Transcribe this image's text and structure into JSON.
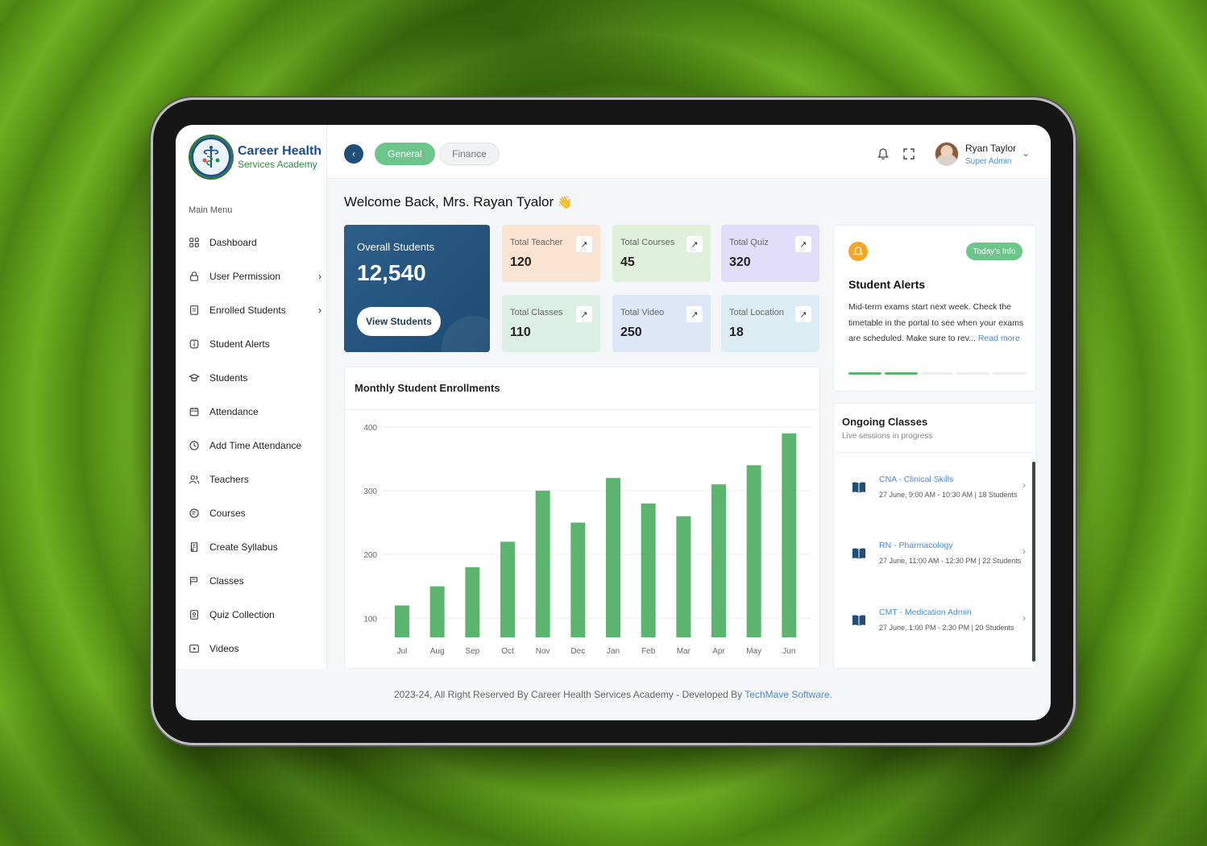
{
  "brand": {
    "title": "Career Health",
    "subtitle": "Services Academy"
  },
  "sidebar": {
    "menu_label": "Main Menu",
    "items": [
      {
        "label": "Dashboard",
        "icon": "grid-icon",
        "has_children": false
      },
      {
        "label": "User Permission",
        "icon": "lock-icon",
        "has_children": true
      },
      {
        "label": "Enrolled Students",
        "icon": "document-icon",
        "has_children": true
      },
      {
        "label": "Student Alerts",
        "icon": "info-icon",
        "has_children": false
      },
      {
        "label": "Students",
        "icon": "graduation-icon",
        "has_children": false
      },
      {
        "label": "Attendance",
        "icon": "calendar-icon",
        "has_children": false
      },
      {
        "label": "Add Time Attendance",
        "icon": "clock-icon",
        "has_children": false
      },
      {
        "label": "Teachers",
        "icon": "users-icon",
        "has_children": false
      },
      {
        "label": "Courses",
        "icon": "book-icon",
        "has_children": false
      },
      {
        "label": "Create Syllabus",
        "icon": "syllabus-icon",
        "has_children": false
      },
      {
        "label": "Classes",
        "icon": "classes-icon",
        "has_children": false
      },
      {
        "label": "Quiz Collection",
        "icon": "quiz-icon",
        "has_children": false
      },
      {
        "label": "Videos",
        "icon": "video-icon",
        "has_children": false
      }
    ]
  },
  "header": {
    "tabs": [
      {
        "label": "General",
        "active": true
      },
      {
        "label": "Finance",
        "active": false
      }
    ],
    "user": {
      "name": "Ryan Taylor",
      "role": "Super Admin"
    }
  },
  "welcome": {
    "text": "Welcome Back, Mrs. Rayan Tyalor",
    "emoji": "👋"
  },
  "overall": {
    "label": "Overall Students",
    "value": "12,540",
    "button": "View Students"
  },
  "stats": [
    {
      "label": "Total Teacher",
      "value": "120",
      "color": "#fbe3d2"
    },
    {
      "label": "Total Courses",
      "value": "45",
      "color": "#dff0db"
    },
    {
      "label": "Total Quiz",
      "value": "320",
      "color": "#e2defa"
    },
    {
      "label": "Total Classes",
      "value": "110",
      "color": "#dcefe5"
    },
    {
      "label": "Total Video",
      "value": "250",
      "color": "#dde7f8"
    },
    {
      "label": "Total Location",
      "value": "18",
      "color": "#dcecf3"
    }
  ],
  "chart_data": {
    "type": "bar",
    "title": "Monthly Student Enrollments",
    "categories": [
      "Jul",
      "Aug",
      "Sep",
      "Oct",
      "Nov",
      "Dec",
      "Jan",
      "Feb",
      "Mar",
      "Apr",
      "May",
      "Jun"
    ],
    "values": [
      120,
      150,
      180,
      220,
      300,
      250,
      320,
      280,
      260,
      310,
      340,
      390
    ],
    "yticks": [
      100,
      200,
      300,
      400
    ],
    "ylim": [
      70,
      405
    ],
    "color": "#5cb56e",
    "grid": true
  },
  "alerts": {
    "badge": "Today's Info",
    "title": "Student Alerts",
    "text": "Mid-term exams start next week. Check the timetable in the portal to see when your exams are scheduled. Make sure to rev...",
    "more": "Read more",
    "pager_total": 5,
    "pager_active": 2
  },
  "ongoing": {
    "title": "Ongoing Classes",
    "subtitle": "Live sessions in progress",
    "items": [
      {
        "name": "CNA - Clinical Skills",
        "meta": "27 June, 9:00 AM - 10:30 AM | 18 Students"
      },
      {
        "name": "RN - Pharmacology",
        "meta": "27 June, 11:00 AM - 12:30 PM | 22 Students"
      },
      {
        "name": "CMT - Medication Admin",
        "meta": "27 June, 1:00 PM - 2:30 PM | 20 Students"
      }
    ]
  },
  "footer": {
    "text": "2023-24, All Right Reserved By Career Health Services Academy - Developed By ",
    "link": "TechMave Software."
  }
}
